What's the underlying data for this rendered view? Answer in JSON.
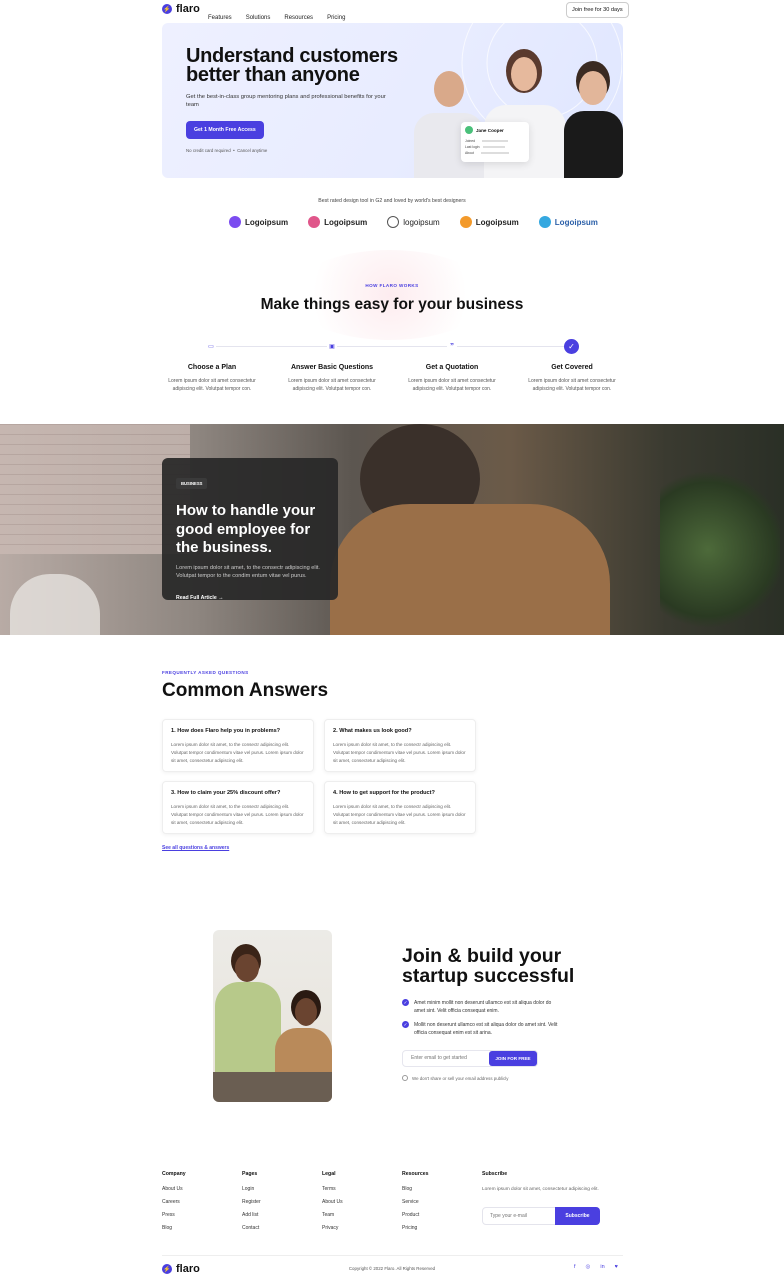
{
  "nav": {
    "brand": "flaro",
    "links": [
      "Features",
      "Solutions",
      "Resources",
      "Pricing"
    ],
    "cta": "Join free for 30 days"
  },
  "hero": {
    "title": "Understand customers better than anyone",
    "subtitle": "Get the best-in-class group mentoring plans and professional benefits for your team",
    "cta": "Get 1 Month Free Access",
    "note1": "No credit card required",
    "note2": "Cancel anytime",
    "profile": {
      "name": "Jane Cooper",
      "rows": [
        "Joined",
        "Last login",
        "About"
      ]
    }
  },
  "logos": {
    "caption": "Best rated design tool in G2 and loved by world's best designers",
    "items": [
      {
        "label": "Logoipsum",
        "color": "#7b4cf0"
      },
      {
        "label": "Logoipsum",
        "color": "#e0568a"
      },
      {
        "label": "logoipsum",
        "color": "#555555"
      },
      {
        "label": "Logoipsum",
        "color": "#f39a2b"
      },
      {
        "label": "Logoipsum",
        "color": "#35a8e0"
      }
    ]
  },
  "how": {
    "eyebrow": "HOW FLARO WORKS",
    "title": "Make things easy for your business",
    "steps": [
      {
        "title": "Choose a Plan",
        "text": "Lorem ipsum dolor sit amet consectetur adipiscing elit. Volutpat tempor con."
      },
      {
        "title": "Answer Basic Questions",
        "text": "Lorem ipsum dolor sit amet consectetur adipiscing elit. Volutpat tempor con."
      },
      {
        "title": "Get a Quotation",
        "text": "Lorem ipsum dolor sit amet consectetur adipiscing elit. Volutpat tempor con."
      },
      {
        "title": "Get Covered",
        "text": "Lorem ipsum dolor sit amet consectetur adipiscing elit. Volutpat tempor con."
      }
    ]
  },
  "article": {
    "tag": "BUSINESS",
    "title": "How to handle your good employee for the business.",
    "text": "Lorem ipsum dolor sit amet, to the consectr adipiscing elit. Volutpat tempor to the condim entum vitae vel purus.",
    "link": "Read Full Article"
  },
  "faq": {
    "eyebrow": "FREQUENTLY ASKED QUESTIONS",
    "title": "Common Answers",
    "items": [
      {
        "q": "1. How does Flaro help you in problems?",
        "a": "Lorem ipsum dolor sit amet, to the consectr adipiscing elit. Volutpat tempor condimentum vitae vel purus. Lorem ipsum dolor sit amet, consectetur adipiscing elit."
      },
      {
        "q": "2. What makes us look good?",
        "a": "Lorem ipsum dolor sit amet, to the consectr adipiscing elit. Volutpat tempor condimentum vitae vel purus. Lorem ipsum dolor sit amet, consectetur adipiscing elit."
      },
      {
        "q": "3. How to claim your 25% discount offer?",
        "a": "Lorem ipsum dolor sit amet, to the consectr adipiscing elit. Volutpat tempor condimentum vitae vel purus. Lorem ipsum dolor sit amet, consectetur adipiscing elit."
      },
      {
        "q": "4. How to get support for the product?",
        "a": "Lorem ipsum dolor sit amet, to the consectr adipiscing elit. Volutpat tempor condimentum vitae vel purus. Lorem ipsum dolor sit amet, consectetur adipiscing elit."
      }
    ],
    "link": "See all questions & answers"
  },
  "join": {
    "title": "Join & build your startup successful",
    "points": [
      "Amet minim mollit non deserunt ullamco est sit aliqua dolor do amet sint. Velit officia consequat enim.",
      "Mollit non deserunt ullamco est sit aliqua dolor do amet sint. Velit officia consequat enim est sit arina."
    ],
    "placeholder": "Enter email to get started",
    "button": "JOIN FOR FREE",
    "note": "We don't share or sell your email address publicly"
  },
  "footer": {
    "columns": [
      {
        "title": "Company",
        "links": [
          "About Us",
          "Careers",
          "Press",
          "Blog"
        ]
      },
      {
        "title": "Pages",
        "links": [
          "Login",
          "Register",
          "Add list",
          "Contact"
        ]
      },
      {
        "title": "Legal",
        "links": [
          "Terms",
          "About Us",
          "Team",
          "Privacy"
        ]
      },
      {
        "title": "Resources",
        "links": [
          "Blog",
          "Service",
          "Product",
          "Pricing"
        ]
      }
    ],
    "subscribe": {
      "title": "Subscribe",
      "text": "Lorem ipsum dolor sit amet, consectetur adipiscing elit.",
      "placeholder": "Type your e-mail",
      "button": "Subscribe"
    },
    "brand": "flaro",
    "copyright": "Copyright © 2022 Flaro. All Rights Reserved",
    "socials": [
      "facebook-icon",
      "instagram-icon",
      "linkedin-icon",
      "twitter-icon"
    ],
    "accent": "#4a3fe0"
  }
}
